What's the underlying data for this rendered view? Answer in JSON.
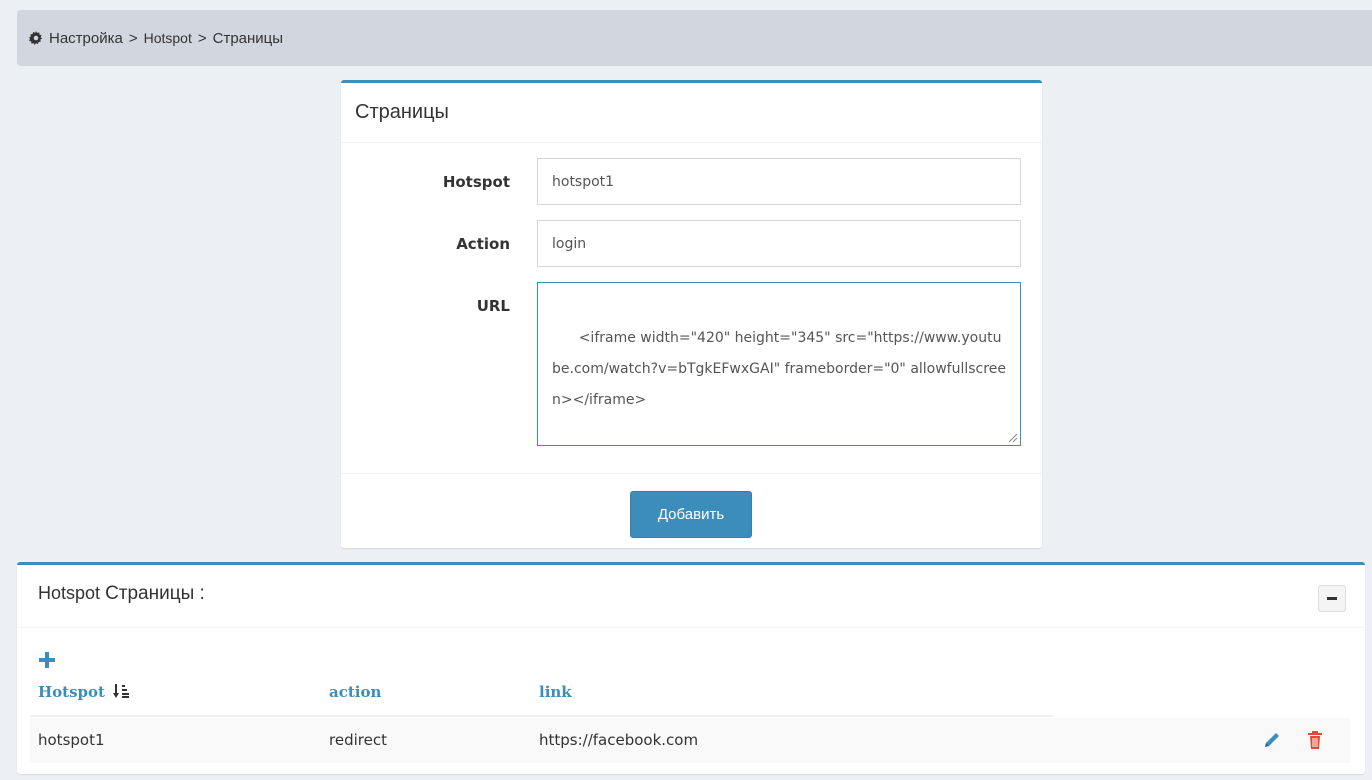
{
  "breadcrumb": {
    "icon": "gear-icon",
    "items": [
      "Настройка",
      "Hotspot",
      "Страницы"
    ],
    "separator": ">"
  },
  "form": {
    "title": "Страницы",
    "fields": {
      "hotspot": {
        "label": "Hotspot",
        "value": "hotspot1"
      },
      "action": {
        "label": "Action",
        "value": "login"
      },
      "url": {
        "label": "URL",
        "value": "<iframe width=\"420\" height=\"345\" src=\"https://www.youtube.com/watch?v=bTgkEFwxGAI\" frameborder=\"0\" allowfullscreen></iframe>"
      }
    },
    "submit_label": "Добавить"
  },
  "list": {
    "title_prefix": "Hotspot",
    "title_main": "Страницы :",
    "columns": [
      "Hotspot",
      "action",
      "link"
    ],
    "rows": [
      {
        "hotspot": "hotspot1",
        "action": "redirect",
        "link": "https://facebook.com"
      }
    ]
  },
  "colors": {
    "accent": "#3c8dbc",
    "background": "#ecf0f5",
    "breadcrumb_bg": "#d2d6de",
    "delete": "#dd4b39"
  }
}
